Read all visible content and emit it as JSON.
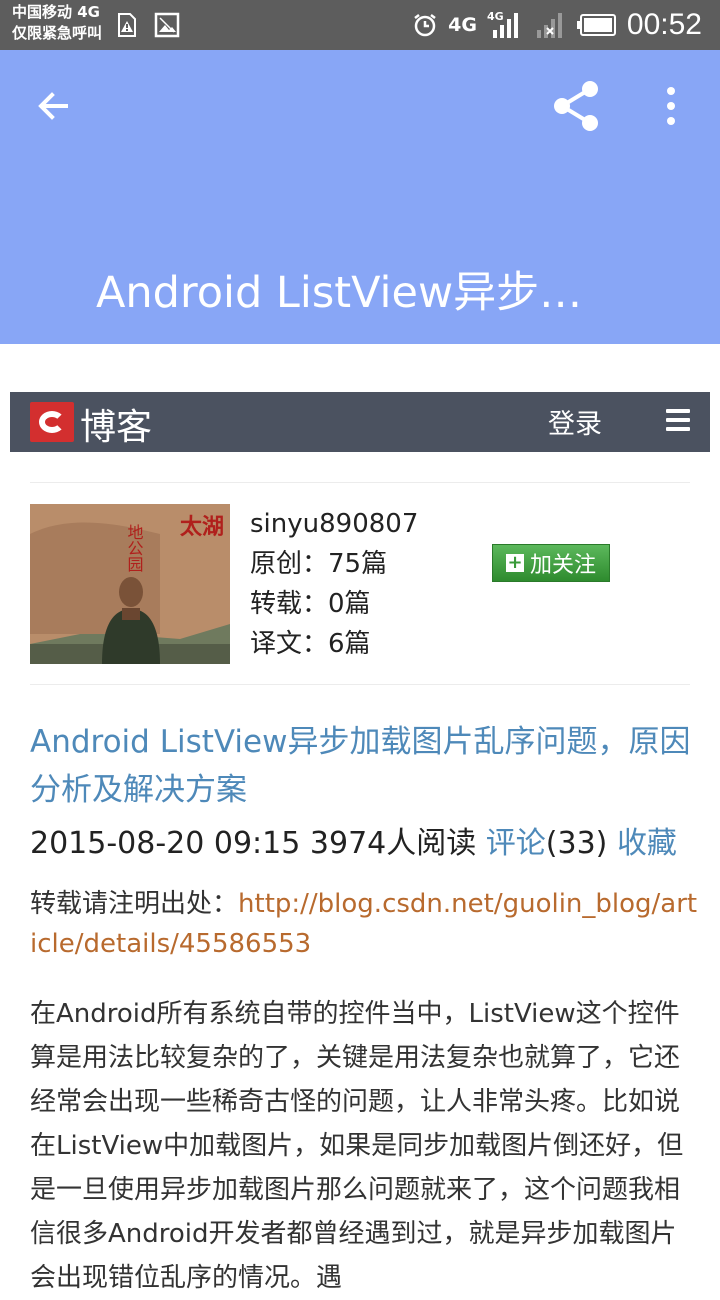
{
  "status_bar": {
    "carrier_line1": "中国移动 4G",
    "carrier_line2": "仅限紧急呼叫",
    "network_label": "4G",
    "network_label_small": "4G",
    "time": "00:52",
    "icons": [
      "sim-warning-icon",
      "image-icon",
      "alarm-icon",
      "signal-icon",
      "signal-off-icon",
      "battery-icon"
    ]
  },
  "app_bar": {
    "title": "Android ListView异步…",
    "color": "#88a6f6",
    "icons": [
      "back-arrow-icon",
      "share-icon",
      "more-vert-icon"
    ]
  },
  "blog_bar": {
    "logo_text": "博客",
    "login_label": "登录",
    "color": "#4b5260"
  },
  "profile": {
    "username": "sinyu890807",
    "original": "原创：75篇",
    "repost": "转载：0篇",
    "translated": "译文：6篇",
    "follow_label": "加关注",
    "avatar_text": [
      "太湖",
      "地公园"
    ]
  },
  "article": {
    "title": "Android ListView异步加载图片乱序问题，原因分析及解决方案",
    "datetime": "2015-08-20 09:15",
    "reads": "3974人阅读",
    "comments_label": "评论",
    "comments_count": "(33)",
    "favorite_label": "收藏",
    "repost_notice": "转载请注明出处：",
    "repost_url": "http://blog.csdn.net/guolin_blog/article/details/45586553",
    "body": "在Android所有系统自带的控件当中，ListView这个控件算是用法比较复杂的了，关键是用法复杂也就算了，它还经常会出现一些稀奇古怪的问题，让人非常头疼。比如说在ListView中加载图片，如果是同步加载图片倒还好，但是一旦使用异步加载图片那么问题就来了，这个问题我相信很多Android开发者都曾经遇到过，就是异步加载图片会出现错位乱序的情况。遇"
  }
}
